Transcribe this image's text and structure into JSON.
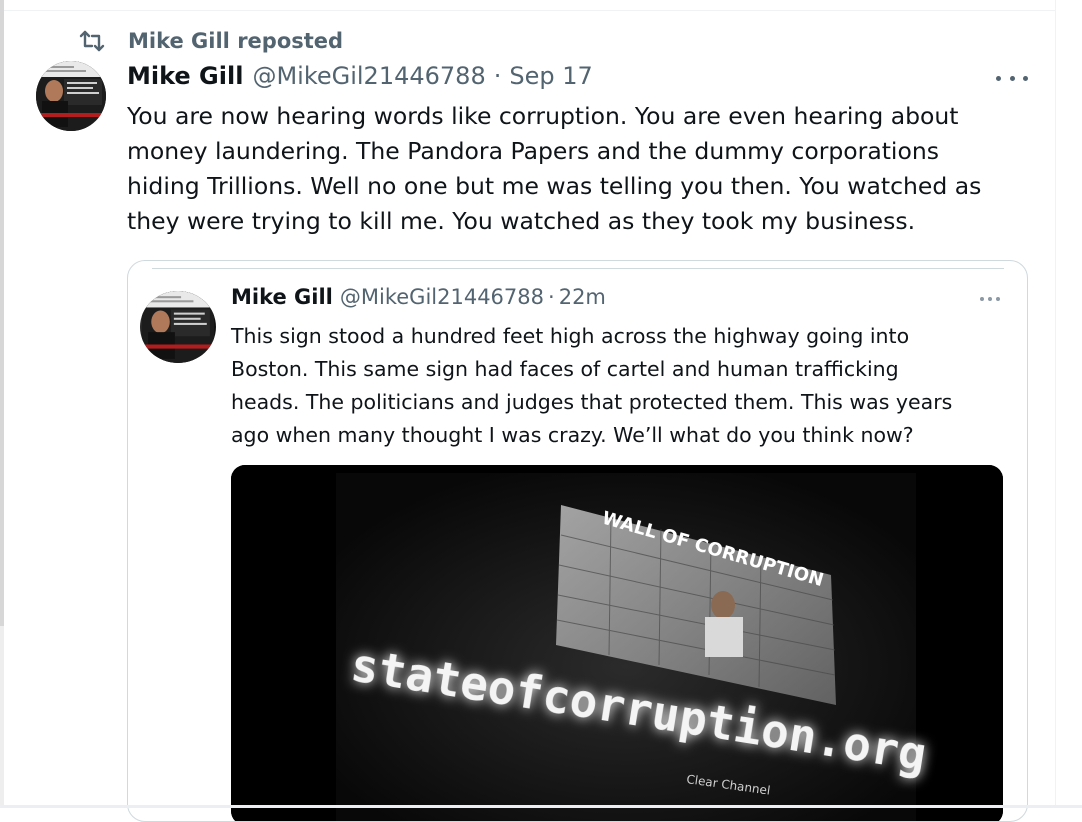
{
  "repost": {
    "icon": "repost-icon",
    "label": "Mike Gill reposted"
  },
  "post": {
    "avatar_icon": "profile-photo",
    "name": "Mike Gill",
    "handle": "@MikeGil21446788",
    "separator": "·",
    "date": "Sep 17",
    "more_icon": "more-horizontal-icon",
    "text": "You are now hearing words like corruption. You are even hearing about\nmoney laundering.  The Pandora Papers and the dummy corporations\nhiding Trillions.  Well no one but me was telling you then. You watched as\nthey were trying to kill me. You watched as they took my business."
  },
  "quote": {
    "name": "Mike Gill",
    "handle": "@MikeGil21446788",
    "separator": "·",
    "time": "22m",
    "more_icon": "more-horizontal-icon",
    "text": "This sign stood a hundred feet high across the highway going into\nBoston. This same sign had faces of cartel and human trafficking\nheads. The politicians and judges that protected them. This was years\nago when many thought I was crazy. We’ll what do you think now?",
    "media": {
      "sign_text": "stateofcorruption.org",
      "banner_text": "WALL OF CORRUPTION",
      "corner_logo": "Clear Channel"
    }
  }
}
